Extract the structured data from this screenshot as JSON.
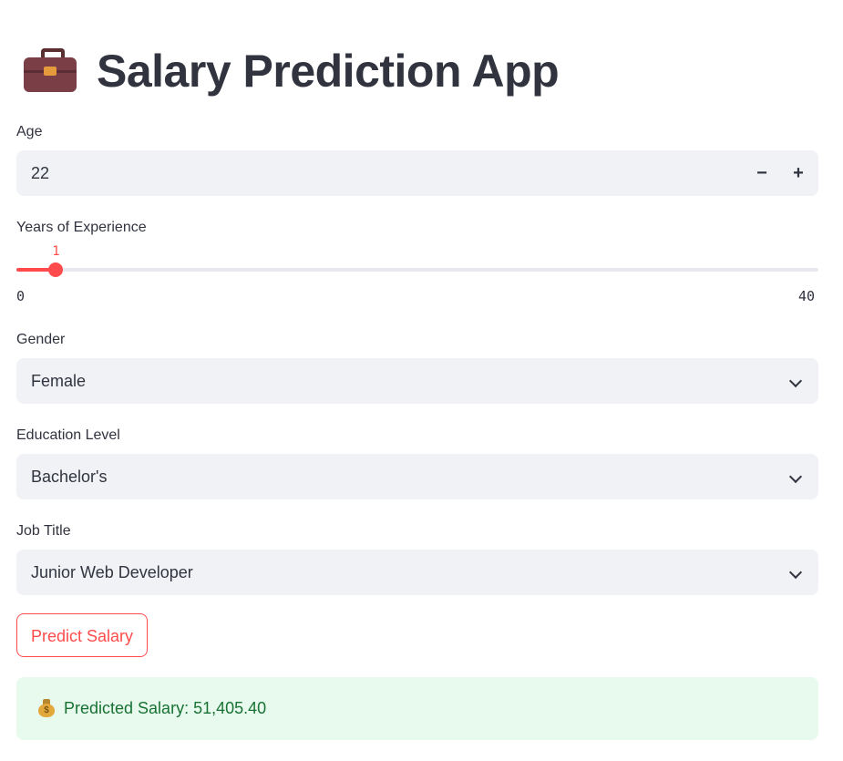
{
  "app": {
    "title": "Salary Prediction App",
    "title_icon": "briefcase-icon"
  },
  "form": {
    "age": {
      "label": "Age",
      "value": "22",
      "decrement_glyph": "−",
      "increment_glyph": "+"
    },
    "experience": {
      "label": "Years of Experience",
      "value": 1,
      "value_text": "1",
      "min": 0,
      "max": 40,
      "min_text": "0",
      "max_text": "40"
    },
    "gender": {
      "label": "Gender",
      "selected": "Female"
    },
    "education": {
      "label": "Education Level",
      "selected": "Bachelor's"
    },
    "job_title": {
      "label": "Job Title",
      "selected": "Junior Web Developer"
    }
  },
  "actions": {
    "predict_label": "Predict Salary"
  },
  "result": {
    "icon": "money-bag-icon",
    "text": "Predicted Salary: 51,405.40"
  },
  "colors": {
    "accent": "#ff4b4b",
    "success_bg": "#e8f9ee",
    "success_text": "#177233",
    "input_bg": "#f0f2f6"
  }
}
